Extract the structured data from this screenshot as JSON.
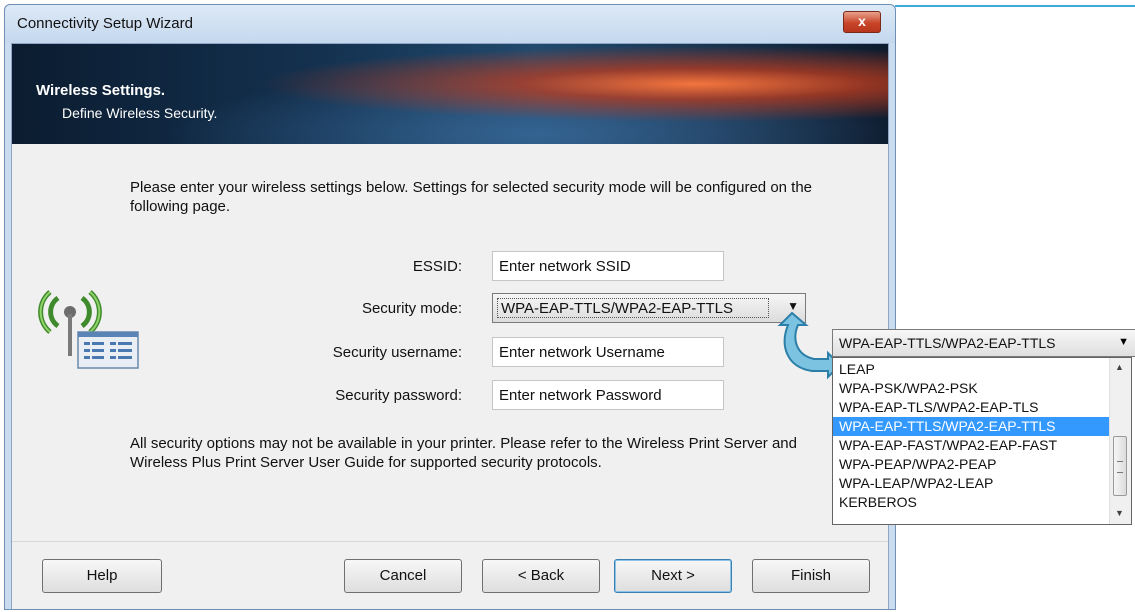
{
  "window": {
    "title": "Connectivity Setup Wizard",
    "close_label": "x"
  },
  "banner": {
    "title": "Wireless Settings.",
    "subtitle": "Define Wireless Security."
  },
  "intro_text": "Please enter your wireless settings below. Settings for selected security mode will be configured on the following page.",
  "form": {
    "essid_label": "ESSID:",
    "essid_value": "Enter network SSID",
    "security_mode_label": "Security mode:",
    "security_mode_value": "WPA-EAP-TTLS/WPA2-EAP-TTLS",
    "username_label": "Security username:",
    "username_value": "Enter network Username",
    "password_label": "Security password:",
    "password_value": "Enter network Password"
  },
  "note_text": "All security options may not be available in your printer. Please refer to the Wireless Print Server and Wireless Plus Print Server User Guide for supported security protocols.",
  "buttons": {
    "help": "Help",
    "cancel": "Cancel",
    "back": "< Back",
    "next": "Next >",
    "finish": "Finish"
  },
  "dropdown": {
    "selected": "WPA-EAP-TTLS/WPA2-EAP-TTLS",
    "options": [
      "LEAP",
      "WPA-PSK/WPA2-PSK",
      "WPA-EAP-TLS/WPA2-EAP-TLS",
      "WPA-EAP-TTLS/WPA2-EAP-TTLS",
      "WPA-EAP-FAST/WPA2-EAP-FAST",
      "WPA-PEAP/WPA2-PEAP",
      "WPA-LEAP/WPA2-LEAP",
      "KERBEROS"
    ]
  },
  "colors": {
    "selection": "#3399ff",
    "callout_arrow": "#4aa3c8",
    "accent_line": "#3fa9d9"
  },
  "icons": [
    "wireless-printer-icon",
    "callout-arrow-icon",
    "chevron-down-icon"
  ]
}
